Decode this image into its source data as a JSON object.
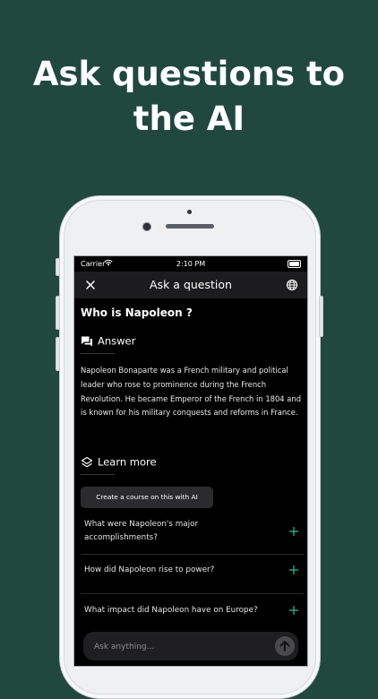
{
  "promo": {
    "headline_line1": "Ask questions to",
    "headline_line2": "the AI"
  },
  "status_bar": {
    "carrier": "Carrier",
    "time": "2:10 PM"
  },
  "nav": {
    "title": "Ask a question",
    "close_icon": "close-icon",
    "globe_icon": "globe-icon"
  },
  "question": "Who is Napoleon ?",
  "answer": {
    "heading": "Answer",
    "icon": "chat-bubbles-icon",
    "text": "Napoleon Bonaparte was a French military and political leader who rose to prominence during the French Revolution. He became Emperor of the French in 1804 and is known for his military conquests and reforms in France."
  },
  "learn_more": {
    "heading": "Learn more",
    "icon": "layers-icon",
    "course_button": "Create a course on this with AI",
    "suggestions": [
      "What were Napoleon's major accomplishments?",
      "How did Napoleon rise to power?",
      "What impact did Napoleon have on Europe?"
    ]
  },
  "ask_bar": {
    "placeholder": "Ask anything..."
  },
  "colors": {
    "background": "#20483f",
    "accent_plus": "#2fbf9a",
    "screen": "#000000",
    "nav_bar": "#1c1c1e"
  }
}
